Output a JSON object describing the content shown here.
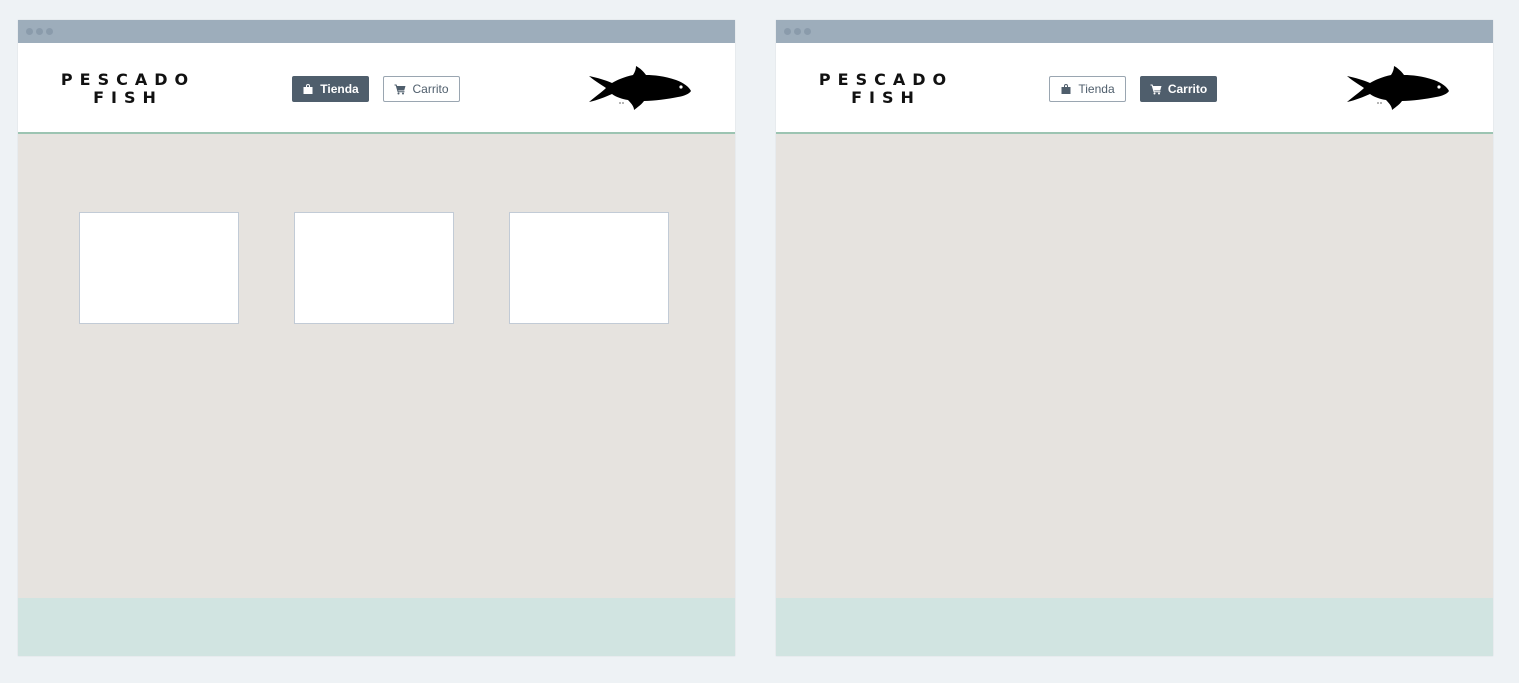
{
  "screens": [
    {
      "id": "shop",
      "logo": {
        "line1": "PESCADO",
        "line2": "FISH"
      },
      "nav": {
        "shop_label": "Tienda",
        "cart_label": "Carrito",
        "active": "shop"
      },
      "product_cards": 3
    },
    {
      "id": "cart",
      "logo": {
        "line1": "PESCADO",
        "line2": "FISH"
      },
      "nav": {
        "shop_label": "Tienda",
        "cart_label": "Carrito",
        "active": "cart"
      },
      "product_cards": 0
    }
  ],
  "icons": {
    "shop": "shopping-bag-icon",
    "cart": "shopping-cart-icon",
    "brand": "fish-icon"
  },
  "colors": {
    "page_bg": "#eef2f5",
    "titlebar": "#9dadbb",
    "header_bg": "#ffffff",
    "header_border": "#9cc4b2",
    "content_bg": "#e6e3df",
    "footer_bg": "#d1e4e1",
    "button_active": "#4f5e6c",
    "card_border": "#c2cbd6"
  }
}
